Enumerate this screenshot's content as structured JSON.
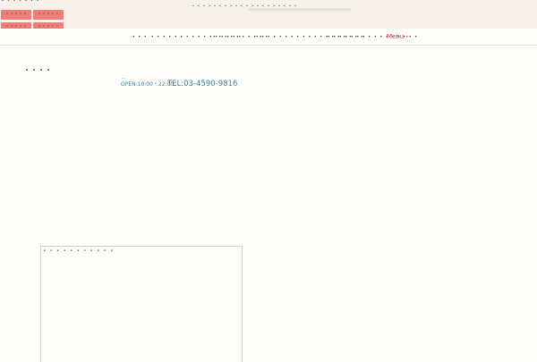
{
  "header": {
    "site_tag": "・・・・・・・",
    "quick_links": [
      {
        "label": "・・・・・"
      },
      {
        "label": "・・・・・"
      },
      {
        "label": "・・・・・"
      },
      {
        "label": "・・・・・"
      }
    ],
    "notice_text": "・・・・・・・・・・・・・・・・・・・・"
  },
  "nav": {
    "items": [
      {
        "label": "・・・"
      },
      {
        "label": "・・・・・・・・・・・・・・・・"
      },
      {
        "label": "・・・・・・・・・・"
      },
      {
        "label": "・・・・・・・・・・・・・・・・・・・"
      },
      {
        "label": "・・・・・・・・・・・・・・・・"
      }
    ],
    "menu_label": "Menu・"
  },
  "shop": {
    "name": "・・・・",
    "hours": "OPEN:10:00・22:00",
    "tel": "TEL:03-4590-9816"
  },
  "widget": {
    "title": "・・・・・・・・・・・"
  },
  "colors": {
    "quick_link_bg": "#f07e76",
    "accent_blue": "#3c7f98",
    "menu_red": "#c9355a",
    "header_bg": "#f7f2e9"
  }
}
